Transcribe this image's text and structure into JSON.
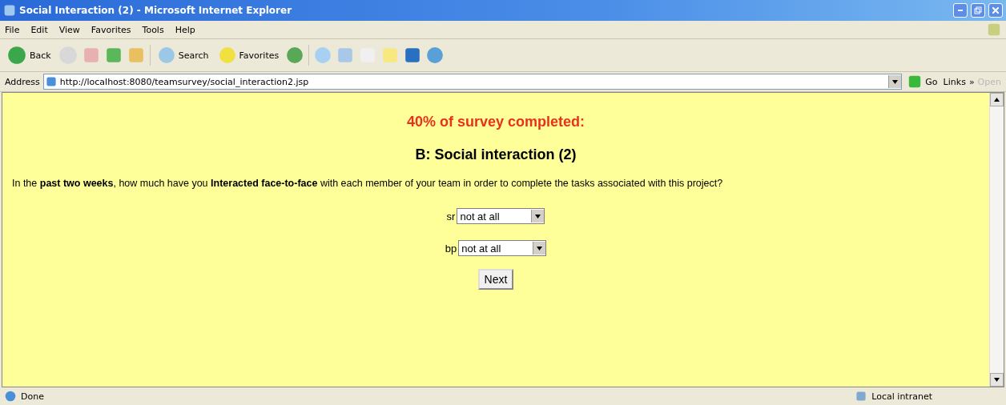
{
  "window": {
    "title": "Social Interaction (2) - Microsoft Internet Explorer"
  },
  "menu": [
    "File",
    "Edit",
    "View",
    "Favorites",
    "Tools",
    "Help"
  ],
  "toolbar": {
    "back": "Back",
    "search": "Search",
    "favorites": "Favorites"
  },
  "address": {
    "label": "Address",
    "url": "http://localhost:8080/teamsurvey/social_interaction2.jsp",
    "go": "Go",
    "links": "Links",
    "links_more": "»",
    "extra": "Open"
  },
  "page": {
    "progress": "40% of survey completed:",
    "heading": "B: Social interaction (2)",
    "question": "In the **past two weeks**, how much have you **Interacted face-to-face** with each member of your team in order to complete the tasks associated with this project?",
    "members": [
      {
        "name": "sr",
        "value": "not at all"
      },
      {
        "name": "bp",
        "value": "not at all"
      }
    ],
    "next": "Next"
  },
  "status_bar": {
    "text": "Done",
    "zone": "Local intranet"
  }
}
